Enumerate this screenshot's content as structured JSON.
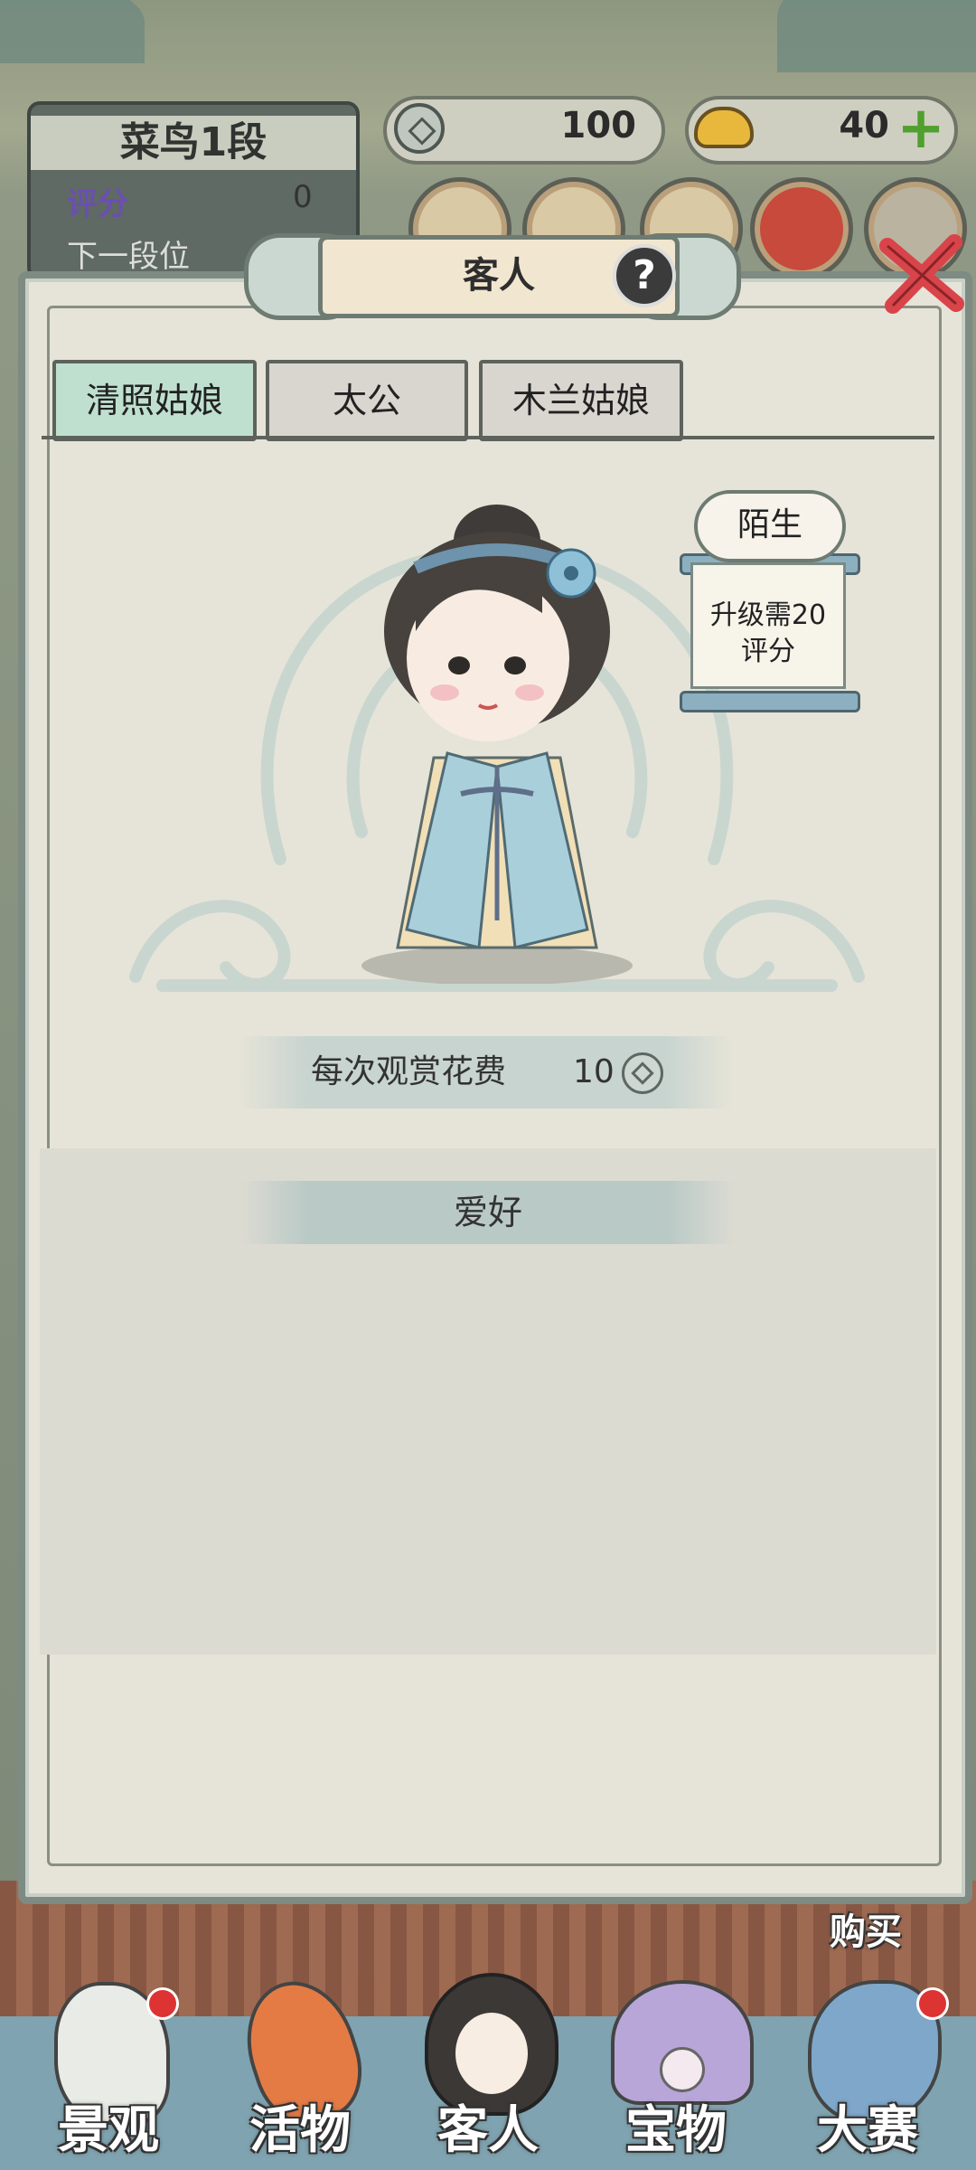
{
  "player": {
    "rank": "菜鸟1段",
    "score_label": "评分",
    "score_value": "0",
    "next_rank_label": "下一段位"
  },
  "currency": {
    "coins": "100",
    "ingots": "40"
  },
  "dialog": {
    "title": "客人",
    "help": "?"
  },
  "tabs": [
    {
      "label": "清照姑娘",
      "active": true
    },
    {
      "label": "太公",
      "active": false
    },
    {
      "label": "木兰姑娘",
      "active": false
    }
  ],
  "status": {
    "relation": "陌生",
    "upgrade_line1": "升级需20",
    "upgrade_line2": "评分"
  },
  "cost": {
    "label": "每次观赏花费",
    "value": "10"
  },
  "hobby": {
    "label": "爱好"
  },
  "buy_label": "购买",
  "bottom_nav": [
    {
      "label": "景观",
      "icon": "rock-icon",
      "badge": true
    },
    {
      "label": "活物",
      "icon": "koi-fish-icon",
      "badge": false
    },
    {
      "label": "客人",
      "icon": "guest-girl-icon",
      "badge": false
    },
    {
      "label": "宝物",
      "icon": "pearl-shell-icon",
      "badge": false
    },
    {
      "label": "大赛",
      "icon": "dragon-carp-icon",
      "badge": true
    }
  ],
  "colors": {
    "active_tab": "#bfe0cf",
    "panel_border": "#7d8b83",
    "badge": "#d33333"
  }
}
